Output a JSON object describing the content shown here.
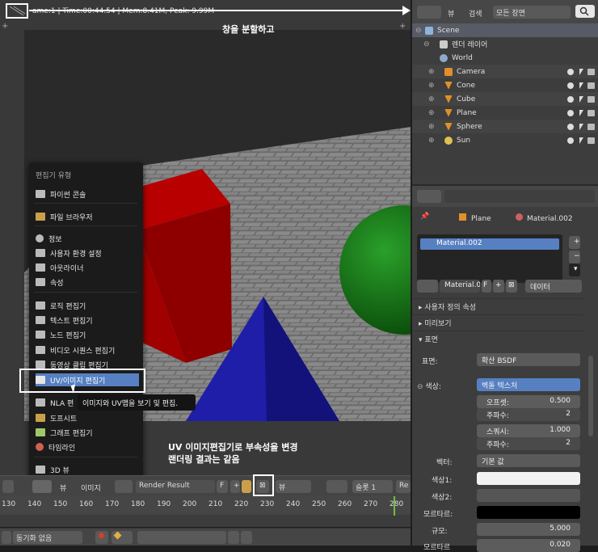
{
  "viewport": {
    "stats": "ame:1 | Time:00:44.54 | Mem:8.41M, Peak: 9.99M",
    "annotation_top": "창을 분할하고",
    "annotation_bottom_1": "UV 이미지편집기로 부속성을 변경",
    "annotation_bottom_2": "랜더링 결과는 같음"
  },
  "editor_menu": {
    "title": "편집기 유형",
    "items": [
      {
        "label": "파이썬 콘솔",
        "icon": "python-console-icon"
      },
      {
        "label": "파일 브라우저",
        "icon": "file-browser-icon"
      },
      {
        "label": "정보",
        "icon": "info-icon"
      },
      {
        "label": "사용자 환경 설정",
        "icon": "preferences-icon"
      },
      {
        "label": "아웃라이너",
        "icon": "outliner-icon"
      },
      {
        "label": "속성",
        "icon": "properties-icon"
      },
      {
        "label": "로직 편집기",
        "icon": "logic-editor-icon"
      },
      {
        "label": "텍스트 편집기",
        "icon": "text-editor-icon"
      },
      {
        "label": "노드 편집기",
        "icon": "node-editor-icon"
      },
      {
        "label": "비디오 시퀀스 편집기",
        "icon": "sequencer-icon"
      },
      {
        "label": "동영상 클립 편집기",
        "icon": "clip-editor-icon"
      },
      {
        "label": "UV/이미지 편집기",
        "icon": "uv-image-editor-icon"
      },
      {
        "label": "NLA 편",
        "icon": "nla-icon"
      },
      {
        "label": "도프시트",
        "icon": "dopesheet-icon"
      },
      {
        "label": "그래프 편집기",
        "icon": "graph-editor-icon"
      },
      {
        "label": "타임라인",
        "icon": "timeline-icon"
      },
      {
        "label": "3D 뷰",
        "icon": "3d-view-icon"
      }
    ],
    "tooltip": "이미지와 UV맵을 보기 및 편집."
  },
  "image_header": {
    "view": "뷰",
    "image": "이미지",
    "image_name": "Render Result",
    "fake_user": "F",
    "view2": "뷰",
    "slot": "슬롯 1",
    "render_layer": "Re"
  },
  "timeline": {
    "ticks": [
      "130",
      "140",
      "150",
      "160",
      "170",
      "180",
      "190",
      "200",
      "210",
      "220",
      "230",
      "240",
      "250",
      "260",
      "270",
      "280"
    ],
    "sync": "동기화 없음"
  },
  "outliner": {
    "view": "뷰",
    "search": "검색",
    "filter": "모든 장면",
    "rows": [
      {
        "name": "Scene",
        "icon": "scene-icon",
        "color": "#8fb3d9"
      },
      {
        "name": "렌더 레이어",
        "icon": "render-layer-icon",
        "color": "#cccccc"
      },
      {
        "name": "World",
        "icon": "world-icon",
        "color": "#8fa9c9"
      },
      {
        "name": "Camera",
        "icon": "camera-icon",
        "color": "#e0902a"
      },
      {
        "name": "Cone",
        "icon": "mesh-icon",
        "color": "#e0902a"
      },
      {
        "name": "Cube",
        "icon": "mesh-icon",
        "color": "#e0902a"
      },
      {
        "name": "Plane",
        "icon": "mesh-icon",
        "color": "#e0902a"
      },
      {
        "name": "Sphere",
        "icon": "mesh-icon",
        "color": "#e0902a"
      },
      {
        "name": "Sun",
        "icon": "lamp-icon",
        "color": "#e0c050"
      }
    ]
  },
  "properties": {
    "breadcrumb_object": "Plane",
    "breadcrumb_material": "Material.002",
    "slot_name": "Material.002",
    "material_field": "Material.0",
    "fake_user": "F",
    "link_mode": "데이터",
    "panel_custom": "사용자 정의 속성",
    "panel_preview": "미리보기",
    "panel_surface": "표면",
    "surface_label": "표면:",
    "surface_value": "확산 BSDF",
    "color_label": "색상:",
    "color_value": "벽돌 텍스처",
    "offset_label": "오프셋:",
    "offset_value": "0.500",
    "freq1_label": "주파수:",
    "freq1_value": "2",
    "squash_label": "스쿼시:",
    "squash_value": "1.000",
    "freq2_label": "주파수:",
    "freq2_value": "2",
    "vector_label": "벡터:",
    "vector_value": "기본 값",
    "color1_label": "색상1:",
    "color2_label": "색상2:",
    "mortar_label": "모르타르:",
    "scale_label": "규모:",
    "scale_value": "5.000",
    "mortar_size_label": "모르타르",
    "mortar_size_value": "0.020"
  }
}
